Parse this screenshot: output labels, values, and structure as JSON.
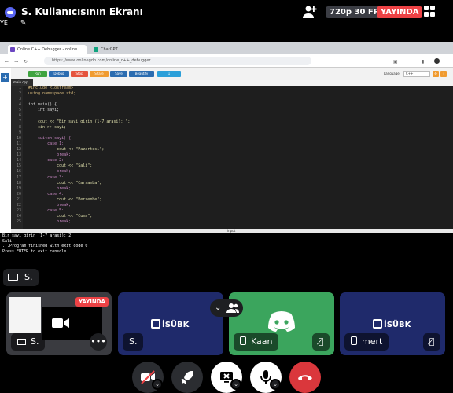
{
  "header": {
    "title": "S. Kullanıcısının Ekranı",
    "subtitle": "YE",
    "quality": "720p 30 FPS",
    "live": "YAYINDA"
  },
  "browser": {
    "tabs": [
      {
        "label": "Online C++ Debugger - online..."
      },
      {
        "label": "ChatGPT"
      }
    ],
    "url": "https://www.onlinegdb.com/online_c++_debugger"
  },
  "ide": {
    "toolbar": [
      "Run",
      "Debug",
      "Stop",
      "Share",
      "Save",
      "Beautify",
      "↓"
    ],
    "language_label": "Language",
    "language_value": "C++",
    "file_tab": "main.cpp",
    "output_label": "input",
    "line_numbers": [
      "1",
      "2",
      "3",
      "4",
      "5",
      "6",
      "7",
      "8",
      "9",
      "10",
      "11",
      "12",
      "13",
      "14",
      "15",
      "16",
      "17",
      "18",
      "19",
      "20",
      "21",
      "22",
      "23",
      "24",
      "25"
    ],
    "code": [
      "#include <iostream>",
      "using namespace std;",
      "",
      "int main() {",
      "    int sayi;",
      "",
      "    cout << \"Bir sayi girin (1-7 arasi): \";",
      "    cin >> sayi;",
      "",
      "    switch(sayi) {",
      "        case 1:",
      "            cout << \"Pazartesi\";",
      "            break;",
      "        case 2:",
      "            cout << \"Sali\";",
      "            break;",
      "        case 3:",
      "            cout << \"Carsamba\";",
      "            break;",
      "        case 4:",
      "            cout << \"Persembe\";",
      "            break;",
      "        case 5:",
      "            cout << \"Cuma\";",
      "            break;"
    ],
    "console": [
      "Bir sayi girin (1-7 arasi): 2",
      "Sali",
      "",
      "...Program finished with exit code 0",
      "Press ENTER to exit console."
    ]
  },
  "stream_owner": "S.",
  "participants": [
    {
      "name": "S.",
      "live": "YAYINDA"
    },
    {
      "name": "S.",
      "logo": "İSÜBK"
    },
    {
      "name": "Kaan"
    },
    {
      "name": "mert",
      "logo": "İSÜBK"
    }
  ],
  "colors": {
    "discord_blurple": "#5865f2",
    "live_red": "#ed4245",
    "speaking_green": "#3ba55d",
    "tile_navy": "#1f2a6b",
    "dark": "#1e1f22"
  }
}
